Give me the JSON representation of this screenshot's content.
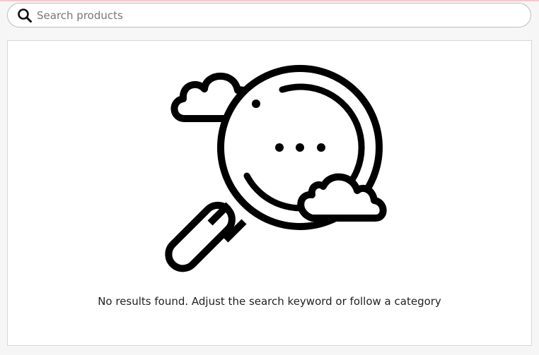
{
  "search": {
    "placeholder": "Search products",
    "value": "",
    "icon": "search-icon"
  },
  "empty_state": {
    "illustration": "magnifier-clouds-icon",
    "message": "No results found. Adjust the search keyword or follow a category"
  },
  "colors": {
    "page_background": "#f6f6f6",
    "top_accent": "#f3c9cc",
    "border": "#bdbdbd",
    "icon_stroke": "#000000"
  }
}
